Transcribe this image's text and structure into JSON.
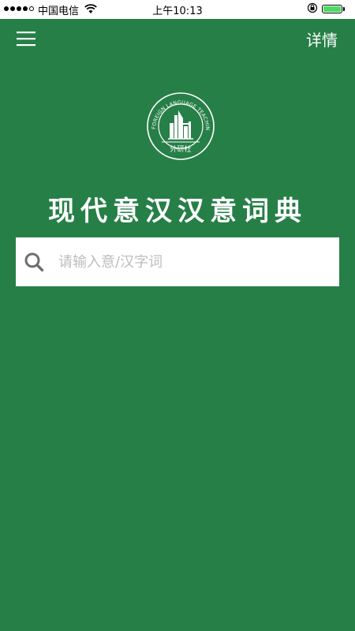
{
  "status_bar": {
    "carrier": "中国电信",
    "time": "上午10:13"
  },
  "nav": {
    "menu_icon": "hamburger-menu-icon",
    "details_label": "详情"
  },
  "logo": {
    "ring_text": "FOREIGN LANGUAGE TEACHING AND RESEARCH PRESS",
    "bottom_text": "外研社"
  },
  "title": "现代意汉汉意词典",
  "search": {
    "placeholder": "请输入意/汉字词",
    "value": "",
    "icon": "search-icon"
  },
  "colors": {
    "background": "#267F47",
    "battery": "#4CD964",
    "placeholder": "#BDBDBD"
  }
}
